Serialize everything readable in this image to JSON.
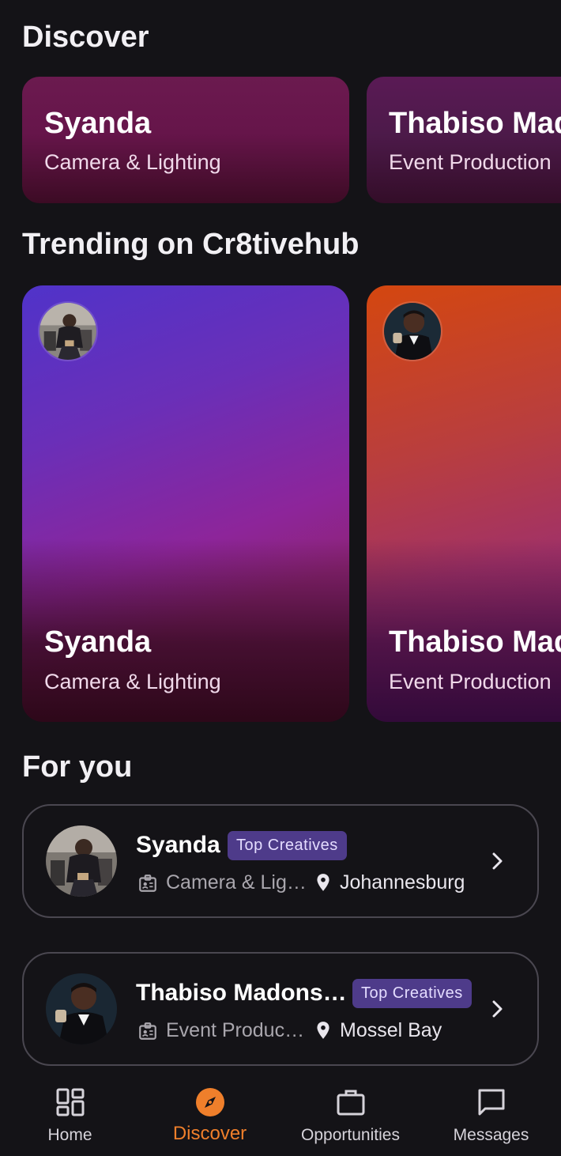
{
  "sections": {
    "discover_title": "Discover",
    "trending_title": "Trending on Cr8tivehub",
    "for_you_title": "For you"
  },
  "discover_cards": [
    {
      "name": "Syanda",
      "category": "Camera & Lighting"
    },
    {
      "name": "Thabiso Madonsela",
      "category": "Event Production"
    }
  ],
  "trending_cards": [
    {
      "name": "Syanda",
      "category": "Camera & Lighting",
      "avatar": "photographer-avatar"
    },
    {
      "name": "Thabiso Madonsela",
      "category": "Event Production",
      "avatar": "suit-man-avatar"
    }
  ],
  "for_you": [
    {
      "name": "Syanda",
      "badge": "Top Creatives",
      "category": "Camera & Lig…",
      "location": "Johannesburg"
    },
    {
      "name": "Thabiso Madons…",
      "badge": "Top Creatives",
      "category": "Event Produc…",
      "location": "Mossel Bay"
    }
  ],
  "nav": {
    "items": [
      {
        "label": "Home",
        "icon": "dashboard-icon"
      },
      {
        "label": "Discover",
        "icon": "compass-icon"
      },
      {
        "label": "Opportunities",
        "icon": "briefcase-icon"
      },
      {
        "label": "Messages",
        "icon": "chat-bubble-icon"
      }
    ],
    "active": "Discover",
    "active_color": "#ef7f2b"
  }
}
